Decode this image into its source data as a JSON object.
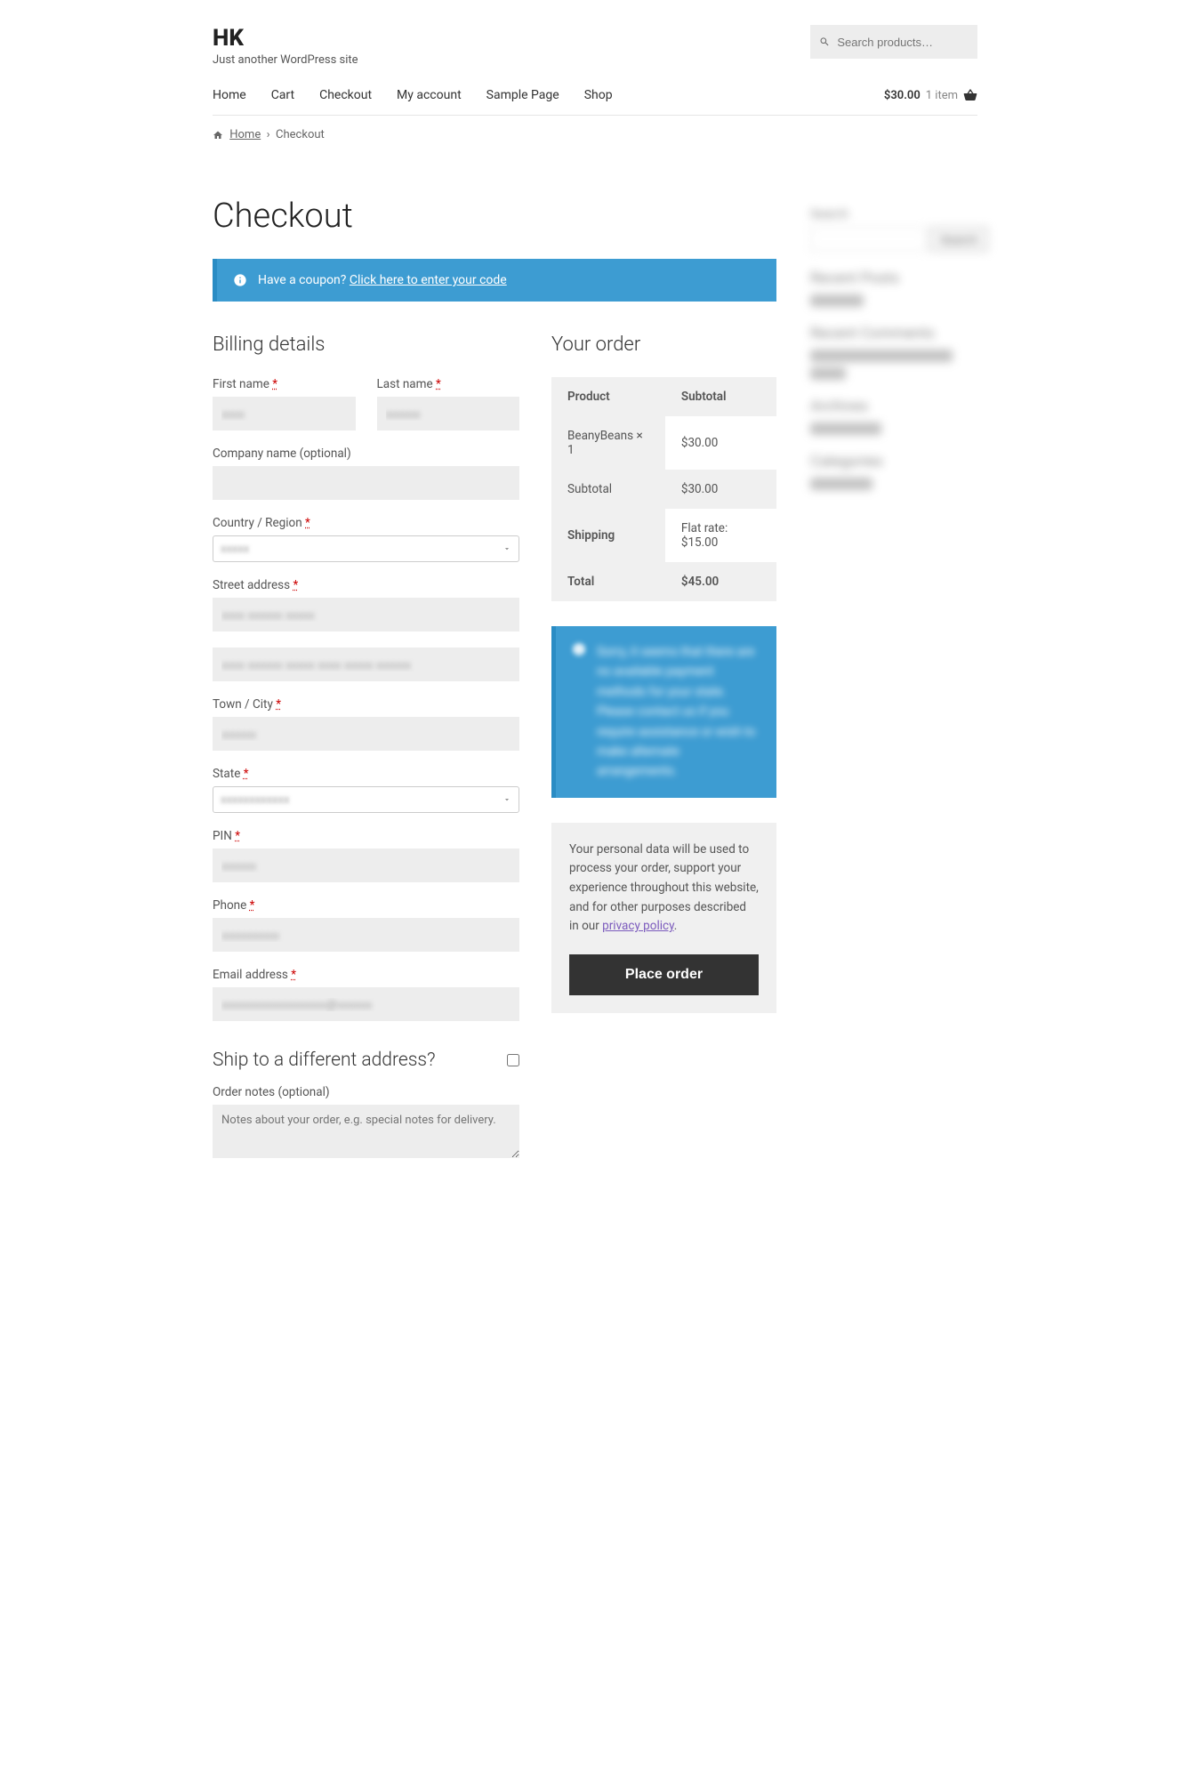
{
  "site": {
    "title": "HK",
    "tagline": "Just another WordPress site"
  },
  "search": {
    "placeholder": "Search products…"
  },
  "nav": {
    "items": [
      "Home",
      "Cart",
      "Checkout",
      "My account",
      "Sample Page",
      "Shop"
    ]
  },
  "cart_summary": {
    "amount": "$30.00",
    "items": "1 item"
  },
  "breadcrumb": {
    "home": "Home",
    "current": "Checkout"
  },
  "page_title": "Checkout",
  "coupon": {
    "prompt": "Have a coupon?",
    "link": "Click here to enter your code"
  },
  "billing": {
    "heading": "Billing details",
    "first_name": {
      "label": "First name",
      "value": "xxxx"
    },
    "last_name": {
      "label": "Last name",
      "value": "xxxxxx"
    },
    "company": {
      "label": "Company name (optional)",
      "value": ""
    },
    "country": {
      "label": "Country / Region",
      "value": "xxxxx"
    },
    "street": {
      "label": "Street address",
      "value1": "xxxx xxxxxx xxxxx",
      "value2": "xxxx xxxxxx xxxxx xxxx xxxxx xxxxxx"
    },
    "city": {
      "label": "Town / City",
      "value": "xxxxxx"
    },
    "state": {
      "label": "State",
      "value": "xxxxxxxxxxxx"
    },
    "pin": {
      "label": "PIN",
      "value": "xxxxxx"
    },
    "phone": {
      "label": "Phone",
      "value": "xxxxxxxxxx"
    },
    "email": {
      "label": "Email address",
      "value": "xxxxxxxxxxxxxxxxxx@xxxxxx"
    }
  },
  "ship_diff": {
    "heading": "Ship to a different address?"
  },
  "order_notes": {
    "label": "Order notes (optional)",
    "placeholder": "Notes about your order, e.g. special notes for delivery."
  },
  "order": {
    "heading": "Your order",
    "cols": {
      "product": "Product",
      "subtotal": "Subtotal"
    },
    "line": {
      "name": "BeanyBeans × 1",
      "amount": "$30.00"
    },
    "subtotal": {
      "label": "Subtotal",
      "amount": "$30.00"
    },
    "shipping": {
      "label": "Shipping",
      "amount": "Flat rate: $15.00"
    },
    "total": {
      "label": "Total",
      "amount": "$45.00"
    }
  },
  "payment_notice": "Sorry, it seems that there are no available payment methods for your state. Please contact us if you require assistance or wish to make alternate arrangements.",
  "privacy": {
    "text": "Your personal data will be used to process your order, support your experience throughout this website, and for other purposes described in our ",
    "link": "privacy policy"
  },
  "place_order": "Place order",
  "sidebar": {
    "search": "Search",
    "recent_posts": "Recent Posts",
    "recent_comments": "Recent Comments",
    "archives": "Archives",
    "categories": "Categories"
  }
}
